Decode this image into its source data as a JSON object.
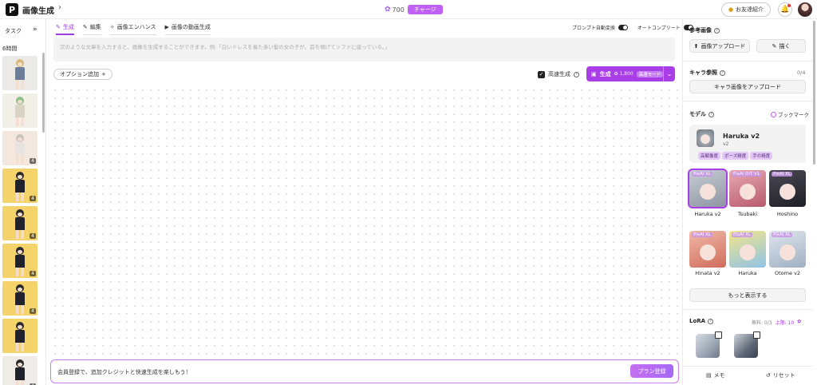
{
  "app": {
    "logo_letter": "P",
    "title": "画像生成",
    "chevron": "›"
  },
  "header": {
    "credits": "700",
    "charge_label": "チャージ",
    "invite_label": "お友達紹介"
  },
  "tasks": {
    "label": "タスク",
    "expand": "»",
    "time_group": "6時間",
    "badges": [
      "4",
      "4",
      "4",
      "4",
      "4",
      "4"
    ]
  },
  "tabs": [
    {
      "icon": "✎",
      "label": "生成"
    },
    {
      "icon": "✎",
      "label": "編集"
    },
    {
      "icon": "✧",
      "label": "画像エンハンス"
    },
    {
      "icon": "▶",
      "label": "画像の動画生成"
    }
  ],
  "toggles": {
    "prompt_translate": "プロンプト自動変換",
    "autocomplete": "オートコンプリート"
  },
  "prompt": {
    "placeholder": "次のような文章を入力すると、画像を生成することができます。例:「白いドレスを着た赤い髪の女の子が、首を傾げてソファに座っている。」"
  },
  "options": {
    "add_label": "オプション追加",
    "plus": "+"
  },
  "fast_gen": {
    "label": "高速生成",
    "check": "✓"
  },
  "generate": {
    "label": "生成",
    "cost": "1,800",
    "pill": "高速モード",
    "caret": "⌄"
  },
  "banner": {
    "text": "会員登録で、追加クレジットと快速生成を楽しもう！",
    "button": "プラン登録"
  },
  "right": {
    "ref_title": "参考画像",
    "upload_label": "画像アップロード",
    "draw_label": "描く",
    "chara_title": "キャラ参照",
    "chara_count": "0/4",
    "chara_upload": "キャラ画像をアップロード",
    "model_title": "モデル",
    "bookmark_label": "ブックマーク",
    "selected_model": {
      "name": "Haruka v2",
      "version": "v2",
      "tags": [
        "高解像度",
        "ポーズ精度",
        "手の精度"
      ]
    },
    "models": [
      {
        "badge": "PixAI XL",
        "name": "Haruka v2"
      },
      {
        "badge": "PixAI DiT V1",
        "name": "Tsubaki"
      },
      {
        "badge": "PixAI XL",
        "name": "Hoshino"
      },
      {
        "badge": "PixAI XL",
        "name": "Hinata v2"
      },
      {
        "badge": "PixAI XL",
        "name": "Haruka"
      },
      {
        "badge": "PixAI XL",
        "name": "Otome v2"
      }
    ],
    "more_label": "もっと表示する",
    "lora_title": "LoRA",
    "lora_free": "無料: 0/3",
    "lora_limit": "上限: 10",
    "memo_label": "メモ",
    "reset_label": "リセット"
  },
  "colors": {
    "accent": "#a93de8",
    "banner_border": "#c77ef0"
  }
}
